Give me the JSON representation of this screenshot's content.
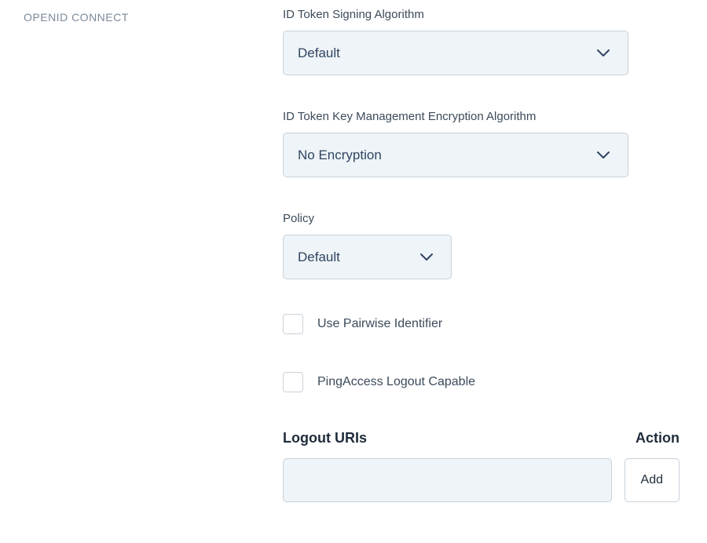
{
  "section_label": "OPENID CONNECT",
  "signing_algo": {
    "label": "ID Token Signing Algorithm",
    "value": "Default"
  },
  "key_mgmt_algo": {
    "label": "ID Token Key Management Encryption Algorithm",
    "value": "No Encryption"
  },
  "policy": {
    "label": "Policy",
    "value": "Default"
  },
  "pairwise_label": "Use Pairwise Identifier",
  "pingaccess_label": "PingAccess Logout Capable",
  "logout_uris": {
    "title": "Logout URIs",
    "action_header": "Action",
    "add_button": "Add",
    "input_value": ""
  }
}
